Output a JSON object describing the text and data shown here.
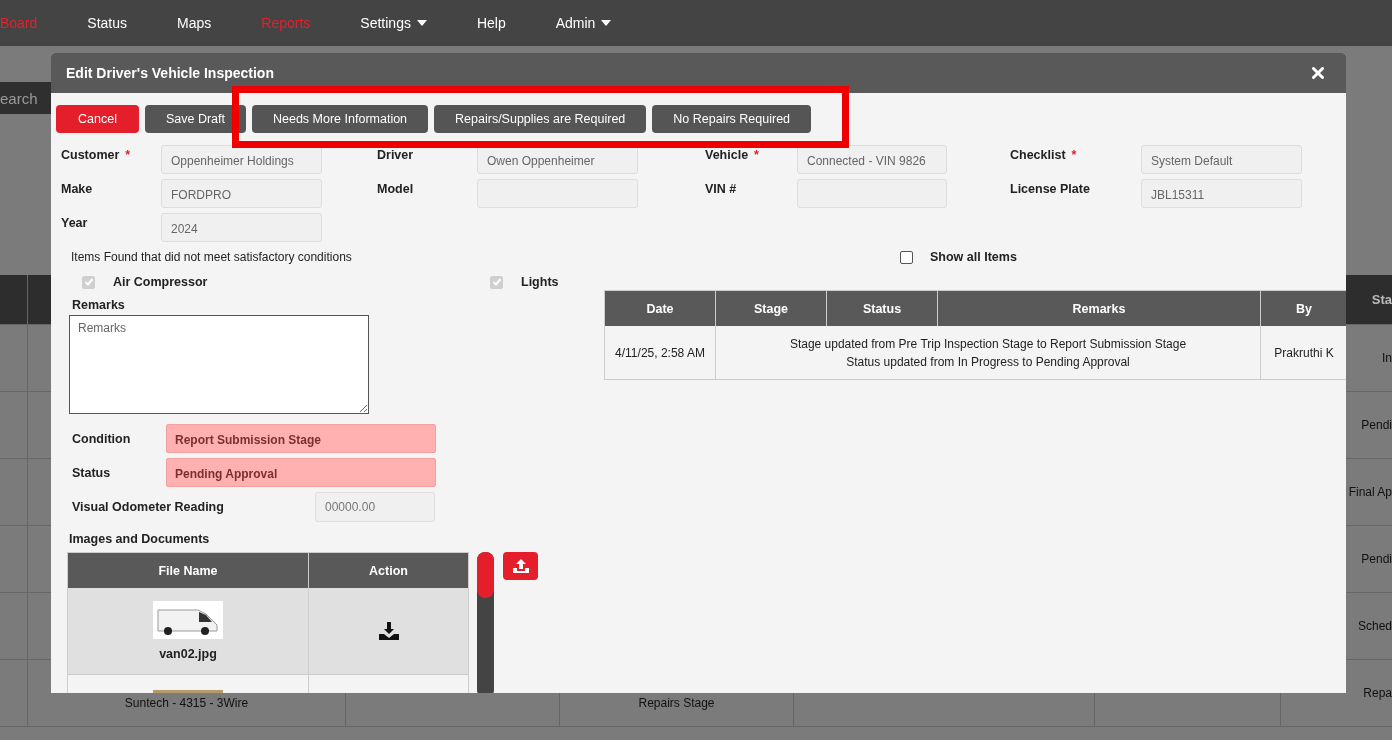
{
  "nav": {
    "items": [
      {
        "label": "Board",
        "selected": true,
        "dropdown": false
      },
      {
        "label": "Status",
        "selected": false,
        "dropdown": false
      },
      {
        "label": "Maps",
        "selected": false,
        "dropdown": false
      },
      {
        "label": "Reports",
        "selected": true,
        "dropdown": false
      },
      {
        "label": "Settings",
        "selected": false,
        "dropdown": true
      },
      {
        "label": "Help",
        "selected": false,
        "dropdown": false
      },
      {
        "label": "Admin",
        "selected": false,
        "dropdown": true
      }
    ]
  },
  "search": {
    "placeholder": "earch"
  },
  "background_table": {
    "column_header": "Sta",
    "rows": [
      {
        "status": "In"
      },
      {
        "status": "Pendi"
      },
      {
        "status": "Final Ap"
      },
      {
        "status": "Pendi"
      },
      {
        "status": "Sched"
      },
      {
        "column_2": "Suntech - 4315 - 3Wire",
        "column_4": "Repairs Stage",
        "status": "Repa"
      }
    ]
  },
  "modal": {
    "title": "Edit Driver's Vehicle Inspection",
    "buttons": [
      {
        "label": "Cancel",
        "kind": "danger"
      },
      {
        "label": "Save Draft",
        "kind": "default"
      },
      {
        "label": "Needs More Information",
        "kind": "default"
      },
      {
        "label": "Repairs/Supplies are Required",
        "kind": "default"
      },
      {
        "label": "No Repairs Required",
        "kind": "default"
      }
    ],
    "field_rows": [
      [
        {
          "label": "Customer",
          "required_mark": "*",
          "value": "Oppenheimer Holdings"
        },
        {
          "label": "Driver",
          "value": "Owen Oppenheimer"
        },
        {
          "label": "Vehicle",
          "required_mark": "*",
          "value": "Connected - VIN 9826"
        },
        {
          "label": "Checklist",
          "required_mark": "*",
          "value": "System Default"
        }
      ],
      [
        {
          "label": "Make",
          "value": "FORDPRO"
        },
        {
          "label": "Model"
        },
        {
          "label": "VIN #"
        },
        {
          "label": "License Plate",
          "value": "JBL15311"
        }
      ],
      [
        {
          "label": "Year",
          "value": "2024"
        }
      ]
    ],
    "items_found": {
      "label": "Items Found that did not meet satisfactory conditions",
      "items": [
        {
          "label": "Air Compressor",
          "checked": true
        },
        {
          "label": "Lights",
          "checked": true
        }
      ]
    },
    "show_all": {
      "label": "Show all Items",
      "checked": false
    },
    "remarks": {
      "label": "Remarks",
      "placeholder": "Remarks"
    },
    "status_fields": [
      {
        "label": "Condition",
        "value": "Report Submission Stage"
      },
      {
        "label": "Status",
        "value": "Pending Approval"
      }
    ],
    "odometer": {
      "label": "Visual Odometer Reading",
      "placeholder": "00000.00"
    },
    "images": {
      "label": "Images and Documents",
      "columns": [
        "File Name",
        "Action"
      ],
      "rows": [
        {
          "file_name": "van02.jpg",
          "kind": "van"
        },
        {
          "kind": "photo"
        }
      ]
    },
    "history": {
      "columns": [
        "Date",
        "Stage",
        "Status",
        "Remarks",
        "By"
      ],
      "rows": [
        {
          "date": "4/11/25, 2:58 AM",
          "remarks": [
            "Stage updated from Pre Trip Inspection Stage to Report Submission Stage",
            "Status updated from In Progress to Pending Approval"
          ],
          "by": "Prakruthi K"
        }
      ]
    }
  }
}
